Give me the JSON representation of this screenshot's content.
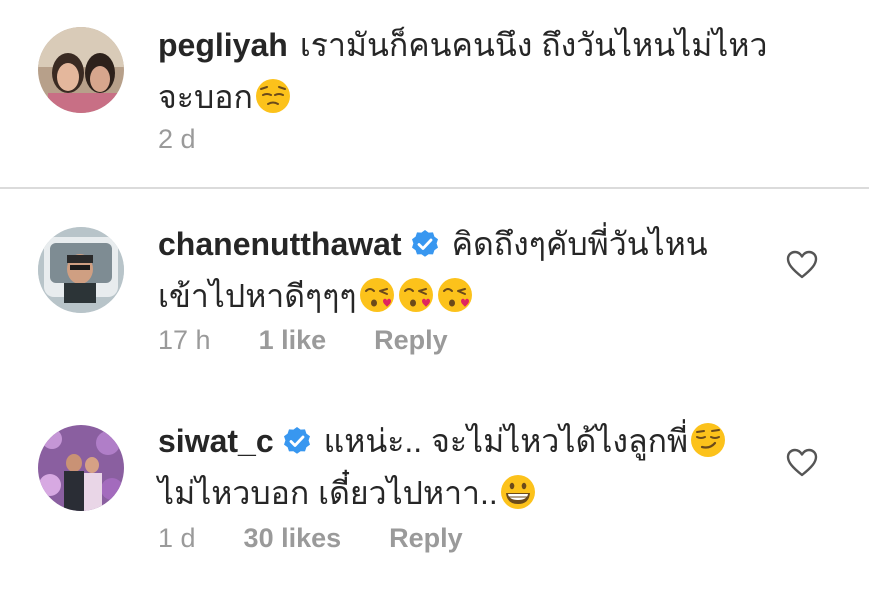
{
  "comments": [
    {
      "username": "pegliyah",
      "verified": false,
      "line1": "เรามันก็คนคนนึง ถึงวันไหนไม่ไหว",
      "line2": "จะบอก",
      "time": "2 d",
      "likes": "",
      "reply": "",
      "emoji": [
        "pensive-face"
      ]
    },
    {
      "username": "chanenutthawat",
      "verified": true,
      "line1": "คิดถึงๆคับพี่วันไหน",
      "line2": "เข้าไปหาดีๆๆๆ",
      "time": "17 h",
      "likes": "1 like",
      "reply": "Reply",
      "emoji": [
        "face-blowing-kiss",
        "face-blowing-kiss",
        "face-blowing-kiss"
      ]
    },
    {
      "username": "siwat_c",
      "verified": true,
      "line1": "แหน่ะ.. จะไม่ไหวได้ไงลูกพี่",
      "line2": "ไม่ไหวบอก เดี๋ยวไปหาา..",
      "time": "1 d",
      "likes": "30 likes",
      "reply": "Reply",
      "emoji": [
        "smirking-face",
        "grinning-face"
      ]
    }
  ],
  "icons": {
    "verified": "verified-badge-icon",
    "like": "heart-outline-icon"
  },
  "colors": {
    "text": "#262626",
    "meta": "#9a9a9a",
    "verified_blue": "#3897f0",
    "divider": "#dbdbdb",
    "emoji_yellow": "#fcc21b",
    "heart_stroke": "#555555"
  }
}
